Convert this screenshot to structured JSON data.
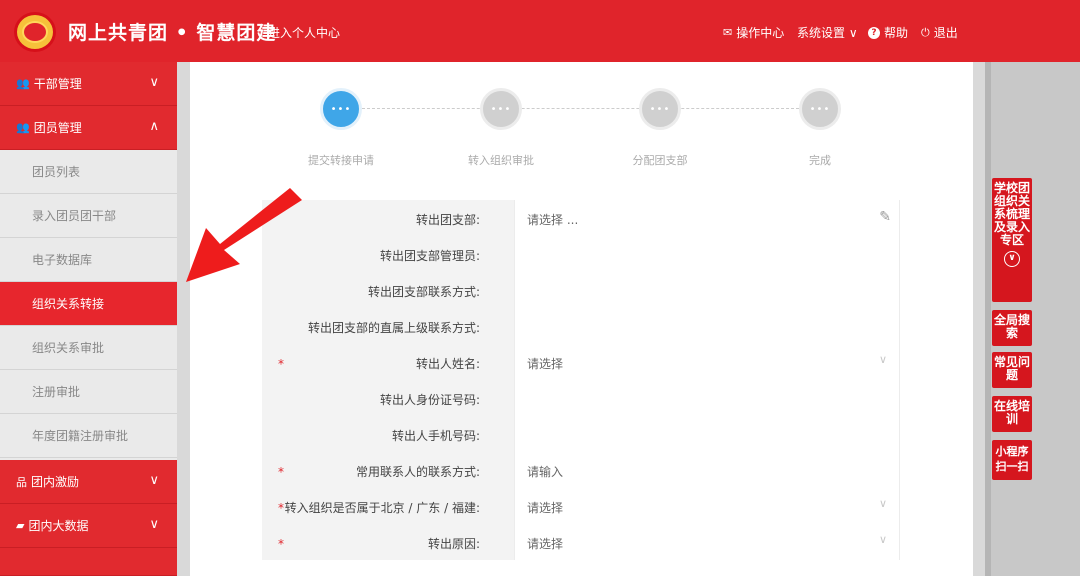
{
  "header": {
    "title": "网上共青团 • 智慧团建",
    "personal_center": "进入个人中心",
    "nav": [
      {
        "icon": "envelope-icon",
        "glyph": "✉",
        "label": "操作中心"
      },
      {
        "icon": "chevron-down-icon",
        "glyph": "",
        "label": "系统设置 ∨"
      },
      {
        "icon": "help-icon",
        "glyph": "?",
        "label": "帮助"
      },
      {
        "icon": "power-icon",
        "glyph": "⏻",
        "label": "退出"
      }
    ]
  },
  "sidebar": {
    "groups": [
      {
        "label": "干部管理",
        "icon": "users-icon",
        "glyph": "👥",
        "chevron": "∨"
      },
      {
        "label": "团员管理",
        "icon": "users-icon",
        "glyph": "👥",
        "chevron": "∧"
      },
      {
        "label": "团内激励",
        "icon": "sitemap-icon",
        "glyph": "品",
        "chevron": "∨"
      },
      {
        "label": "团内大数据",
        "icon": "folder-icon",
        "glyph": "▰",
        "chevron": "∨"
      }
    ],
    "items": [
      {
        "label": "团员列表"
      },
      {
        "label": "录入团员团干部"
      },
      {
        "label": "电子数据库"
      },
      {
        "label": "组织关系转接"
      },
      {
        "label": "组织关系审批"
      },
      {
        "label": "注册审批"
      },
      {
        "label": "年度团籍注册审批"
      }
    ]
  },
  "steps": [
    {
      "label": "提交转接申请",
      "dots": "•••"
    },
    {
      "label": "转入组织审批",
      "dots": "•••"
    },
    {
      "label": "分配团支部",
      "dots": "•••"
    },
    {
      "label": "完成",
      "dots": "•••"
    }
  ],
  "form": {
    "rows": [
      {
        "label": "转出团支部:",
        "value": "请选择 ...",
        "required": false,
        "control": "edit"
      },
      {
        "label": "转出团支部管理员:",
        "value": "",
        "required": false,
        "control": "none"
      },
      {
        "label": "转出团支部联系方式:",
        "value": "",
        "required": false,
        "control": "none"
      },
      {
        "label": "转出团支部的直属上级联系方式:",
        "value": "",
        "required": false,
        "control": "none"
      },
      {
        "label": "转出人姓名:",
        "value": "请选择",
        "required": true,
        "control": "select"
      },
      {
        "label": "转出人身份证号码:",
        "value": "",
        "required": false,
        "control": "none"
      },
      {
        "label": "转出人手机号码:",
        "value": "",
        "required": false,
        "control": "none"
      },
      {
        "label": "常用联系人的联系方式:",
        "value": "请输入",
        "required": true,
        "control": "input"
      },
      {
        "label": "转入组织是否属于北京 / 广东 / 福建:",
        "value": "请选择",
        "required": true,
        "control": "select"
      },
      {
        "label": "转出原因:",
        "value": "请选择",
        "required": true,
        "control": "select"
      }
    ],
    "required_mark": "*",
    "caret_glyph": "∨",
    "edit_glyph": "✎"
  },
  "float_tabs": [
    {
      "label": "学校团组织关系梳理及录入专区",
      "has_down": true,
      "down_glyph": "∨"
    },
    {
      "label": "全局搜索"
    },
    {
      "label": "常见问题"
    },
    {
      "label": "在线培训"
    },
    {
      "label": "小程序扫一扫"
    }
  ],
  "colors": {
    "brand": "#e0242b",
    "active_step": "#3fa6e8",
    "sidebar_bg": "#eaeaea"
  }
}
